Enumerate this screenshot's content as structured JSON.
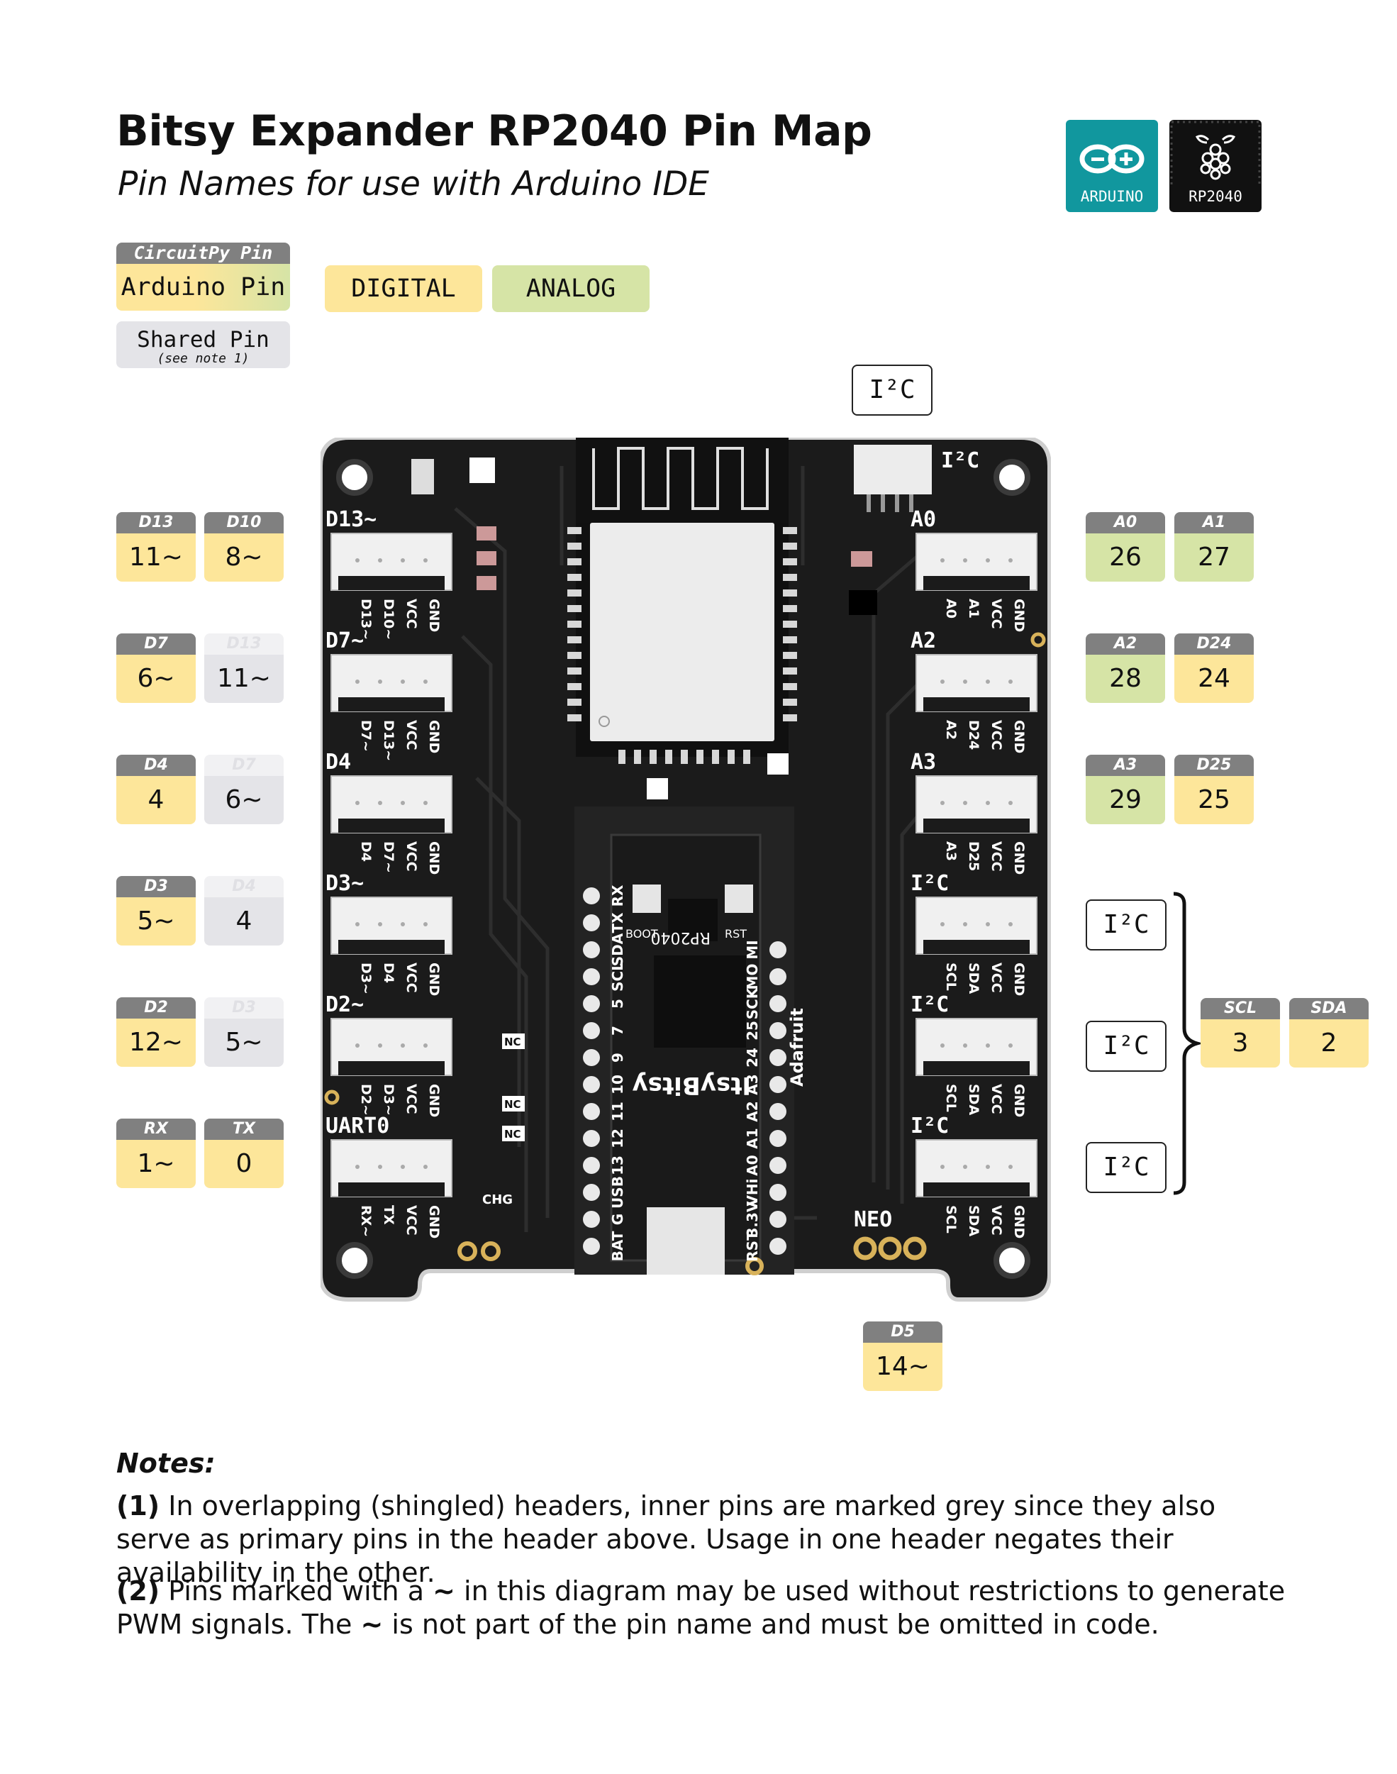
{
  "header": {
    "title": "Bitsy Expander RP2040 Pin Map",
    "subtitle": "Pin Names for use with Arduino IDE"
  },
  "logos": {
    "arduino": {
      "label": "ARDUINO",
      "color": "#11979e"
    },
    "rp2040": {
      "label": "RP2040",
      "color": "#111111"
    }
  },
  "legend": {
    "circuitpy": "CircuitPy Pin",
    "arduino": "Arduino Pin",
    "digital": "DIGITAL",
    "analog": "ANALOG",
    "shared": "Shared Pin",
    "shared_note": "(see note 1)",
    "colors": {
      "digital": "#fde69a",
      "analog": "#d6e4a6",
      "shared": "#e4e4e8",
      "header": "#808080"
    }
  },
  "top_i2c": "I²C",
  "left_pins": [
    [
      {
        "cp": "D13",
        "ard": "11~",
        "kind": "digital"
      },
      {
        "cp": "D10",
        "ard": "8~",
        "kind": "digital"
      }
    ],
    [
      {
        "cp": "D7",
        "ard": "6~",
        "kind": "digital"
      },
      {
        "cp": "D13",
        "ard": "11~",
        "kind": "shared"
      }
    ],
    [
      {
        "cp": "D4",
        "ard": "4",
        "kind": "digital"
      },
      {
        "cp": "D7",
        "ard": "6~",
        "kind": "shared"
      }
    ],
    [
      {
        "cp": "D3",
        "ard": "5~",
        "kind": "digital"
      },
      {
        "cp": "D4",
        "ard": "4",
        "kind": "shared"
      }
    ],
    [
      {
        "cp": "D2",
        "ard": "12~",
        "kind": "digital"
      },
      {
        "cp": "D3",
        "ard": "5~",
        "kind": "shared"
      }
    ],
    [
      {
        "cp": "RX",
        "ard": "1~",
        "kind": "digital"
      },
      {
        "cp": "TX",
        "ard": "0",
        "kind": "digital"
      }
    ]
  ],
  "right_pins": [
    [
      {
        "cp": "A0",
        "ard": "26",
        "kind": "analog"
      },
      {
        "cp": "A1",
        "ard": "27",
        "kind": "analog"
      }
    ],
    [
      {
        "cp": "A2",
        "ard": "28",
        "kind": "analog"
      },
      {
        "cp": "D24",
        "ard": "24",
        "kind": "digital"
      }
    ],
    [
      {
        "cp": "A3",
        "ard": "29",
        "kind": "analog"
      },
      {
        "cp": "D25",
        "ard": "25",
        "kind": "digital"
      }
    ]
  ],
  "right_i2c": [
    "I²C",
    "I²C",
    "I²C"
  ],
  "i2c_pins": [
    {
      "cp": "SCL",
      "ard": "3",
      "kind": "digital"
    },
    {
      "cp": "SDA",
      "ard": "2",
      "kind": "digital"
    }
  ],
  "bottom_pin": {
    "cp": "D5",
    "ard": "14~",
    "kind": "digital"
  },
  "board": {
    "left_connectors": [
      {
        "label": "D13~",
        "pins": [
          "D13~",
          "D10~",
          "VCC",
          "GND"
        ]
      },
      {
        "label": "D7~",
        "pins": [
          "D7~",
          "D13~",
          "VCC",
          "GND"
        ]
      },
      {
        "label": "D4",
        "pins": [
          "D4",
          "D7~",
          "VCC",
          "GND"
        ]
      },
      {
        "label": "D3~",
        "pins": [
          "D3~",
          "D4",
          "VCC",
          "GND"
        ]
      },
      {
        "label": "D2~",
        "pins": [
          "D2~",
          "D3~",
          "VCC",
          "GND"
        ]
      },
      {
        "label": "UART0",
        "pins": [
          "RX~",
          "TX",
          "VCC",
          "GND"
        ]
      }
    ],
    "right_connectors": [
      {
        "label": "A0",
        "pins": [
          "A0",
          "A1",
          "VCC",
          "GND"
        ]
      },
      {
        "label": "A2",
        "pins": [
          "A2",
          "D24",
          "VCC",
          "GND"
        ]
      },
      {
        "label": "A3",
        "pins": [
          "A3",
          "D25",
          "VCC",
          "GND"
        ]
      },
      {
        "label": "I²C",
        "pins": [
          "SCL",
          "SDA",
          "VCC",
          "GND"
        ]
      },
      {
        "label": "I²C",
        "pins": [
          "SCL",
          "SDA",
          "VCC",
          "GND"
        ]
      },
      {
        "label": "I²C",
        "pins": [
          "SCL",
          "SDA",
          "VCC",
          "GND"
        ]
      }
    ],
    "i2c_port_label": "I²C",
    "neo_label": "NEO",
    "chg_label": "CHG",
    "nc_label": "NC",
    "itsy_left_pins": [
      "BAT",
      "G",
      "USB",
      "13",
      "12",
      "11",
      "10",
      "9",
      "7",
      "5",
      "SCL",
      "SDA",
      "TX",
      "RX"
    ],
    "itsy_right_pins": [
      "RST",
      "3.3V",
      "VHi",
      "A0",
      "A1",
      "A2",
      "A3",
      "24",
      "25",
      "SCK",
      "MO",
      "MI"
    ],
    "itsy_brand": "Adafruit",
    "itsy_name": "ItsyBitsy",
    "itsy_chip": "RP2040",
    "boot_label": "BOOT",
    "rst_label": "RST"
  },
  "notes": {
    "heading": "Notes:",
    "note1_num": "(1)",
    "note1_text": " In overlapping (shingled) headers, inner pins are marked grey since they also serve as primary pins in the header above. Usage in one header negates their availability in the other.",
    "note2_num": "(2)",
    "note2_a": " Pins marked with a ",
    "note2_tilde": "~",
    "note2_b": " in this diagram may be used without restrictions to generate PWM signals. The ",
    "note2_tilde2": "~",
    "note2_c": " is not part of the pin name and must be omitted in code."
  }
}
